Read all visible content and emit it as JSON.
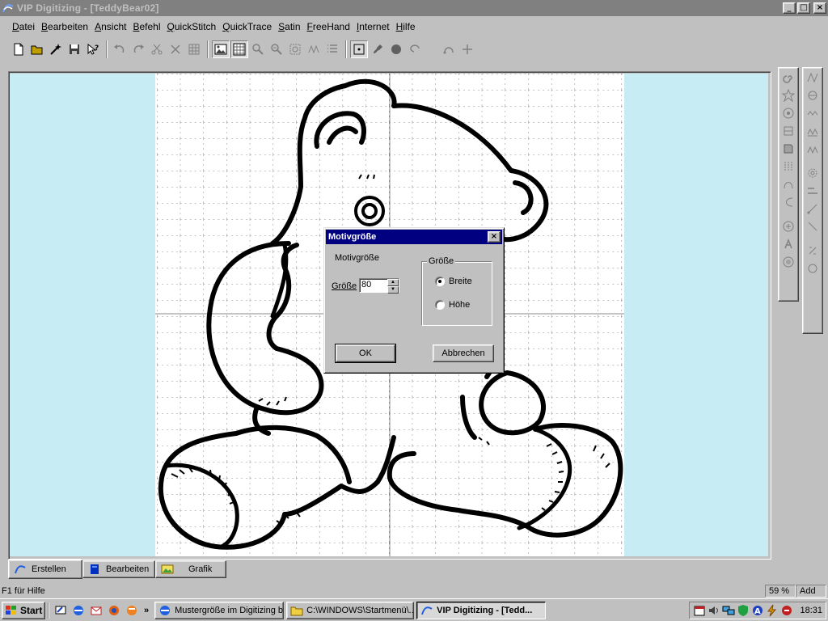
{
  "window": {
    "title": "VIP Digitizing - [TeddyBear02]",
    "controls": {
      "minimize": "_",
      "maximize": "□",
      "close": "×"
    }
  },
  "menu": [
    "Datei",
    "Bearbeiten",
    "Ansicht",
    "Befehl",
    "QuickStitch",
    "QuickTrace",
    "Satin",
    "FreeHand",
    "Internet",
    "Hilfe"
  ],
  "toolbar": {
    "icons": [
      "new-file-icon",
      "open-folder-icon",
      "wizard-icon",
      "save-icon",
      "help-pointer-icon",
      "undo-icon",
      "redo-icon",
      "scissors-icon",
      "cut-icon",
      "grid-table-icon",
      "picture-icon",
      "grid-icon",
      "zoom-in-icon",
      "zoom-out-icon",
      "fit-icon",
      "stitch-icon",
      "list-icon",
      "select-point-icon",
      "paint-icon",
      "circle-fill-icon",
      "lasso-icon",
      "curve-icon",
      "plus-icon"
    ]
  },
  "palette": {
    "left_icons": [
      "spiral-tool-icon",
      "star-tool-icon",
      "spiral2-tool-icon",
      "fill-tool-icon",
      "satin-tool-icon",
      "column-tool-icon",
      "curve-tool-icon",
      "arc-tool-icon",
      "logo-tool-icon",
      "text-tool-icon",
      "monogram-tool-icon"
    ],
    "right_icons": [
      "run-tool-icon",
      "pattern-tool-icon",
      "motif-tool-icon",
      "wave-tool-icon",
      "applique-tool-icon",
      "gear-tool-icon",
      "align-tool-icon",
      "node-tool-icon",
      "point-tool-icon",
      "snap-tool-icon",
      "reshape-tool-icon"
    ]
  },
  "tabs": [
    {
      "label": "Erstellen",
      "icon": "create-icon",
      "active": true
    },
    {
      "label": "Bearbeiten",
      "icon": "edit-icon",
      "active": false
    },
    {
      "label": "Grafik",
      "icon": "graphic-icon",
      "active": false
    }
  ],
  "statusbar": {
    "hint": "F1 für Hilfe",
    "zoom": "59 %",
    "mode": "Add"
  },
  "dialog": {
    "title": "Motivgröße",
    "close": "×",
    "section_label": "Motivgröße",
    "size_label": "Größe",
    "size_value": "80",
    "group_title": "Größe",
    "radio_width": "Breite",
    "radio_height": "Höhe",
    "selected": "width",
    "ok": "OK",
    "cancel": "Abbrechen"
  },
  "taskbar": {
    "start": "Start",
    "chevron": "»",
    "tasks": [
      {
        "label": "Mustergröße im Digitizing b...",
        "icon": "browser-icon",
        "active": false
      },
      {
        "label": "C:\\WINDOWS\\Startmenü\\...",
        "icon": "folder-icon",
        "active": false
      },
      {
        "label": "VIP Digitizing - [Tedd...",
        "icon": "vip-icon",
        "active": true
      }
    ],
    "clock": "18:31"
  }
}
